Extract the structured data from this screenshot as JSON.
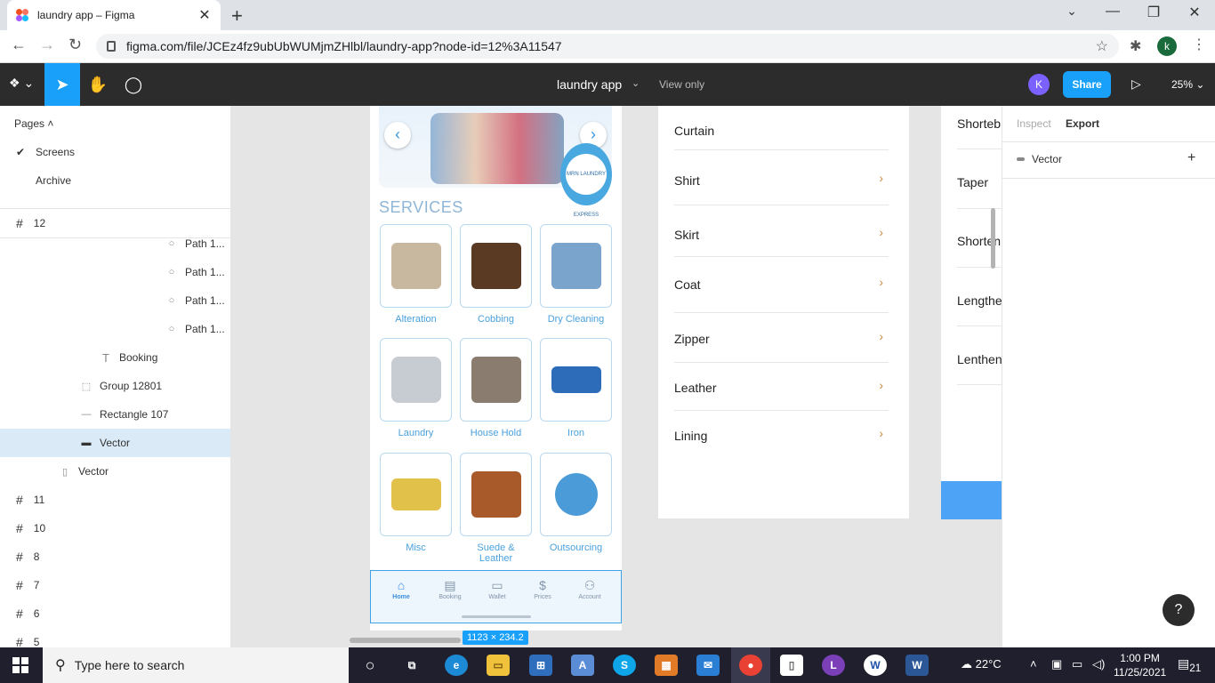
{
  "browser": {
    "tab_title": "laundry app – Figma",
    "tab_close": "✕",
    "new_tab": "+",
    "url": "figma.com/file/JCEz4fz9ubUbWUMjmZHlbl/laundry-app?node-id=12%3A11547",
    "profile_initial": "k",
    "controls": {
      "minimize": "—",
      "restore": "❐",
      "close": "✕",
      "chevron": "⌄"
    }
  },
  "figma": {
    "doc_title": "laundry app",
    "view_only": "View only",
    "avatar": "K",
    "share": "Share",
    "zoom": "25%",
    "tools": [
      "move-tool",
      "hand-tool",
      "comment-tool"
    ]
  },
  "left_panel": {
    "pages_header": "Pages ˄",
    "pages": [
      {
        "label": "Screens",
        "checked": true
      },
      {
        "label": "Archive",
        "checked": false
      }
    ],
    "layers": [
      {
        "label": "12",
        "type": "frame"
      },
      {
        "label": "Path 1...",
        "type": "path"
      },
      {
        "label": "Path 1...",
        "type": "path"
      },
      {
        "label": "Path 1...",
        "type": "path"
      },
      {
        "label": "Path 1...",
        "type": "path"
      },
      {
        "label": "Booking",
        "type": "text"
      },
      {
        "label": "Group 12801",
        "type": "group"
      },
      {
        "label": "Rectangle 107",
        "type": "rectangle"
      },
      {
        "label": "Vector",
        "type": "vector",
        "selected": true
      },
      {
        "label": "Vector",
        "type": "vector"
      },
      {
        "label": "11",
        "type": "frame"
      },
      {
        "label": "10",
        "type": "frame"
      },
      {
        "label": "8",
        "type": "frame"
      },
      {
        "label": "7",
        "type": "frame"
      },
      {
        "label": "6",
        "type": "frame"
      },
      {
        "label": "5",
        "type": "frame"
      }
    ]
  },
  "canvas": {
    "services_title": "SERVICES",
    "badge_text": "MRN LAUNDRY EXPRESS",
    "services": [
      {
        "label": "Alteration",
        "color": "#c9b8a0"
      },
      {
        "label": "Cobbing",
        "color": "#5a3a22"
      },
      {
        "label": "Dry Cleaning",
        "color": "#7aa4cc"
      },
      {
        "label": "Laundry",
        "color": "#c7ccd2"
      },
      {
        "label": "House Hold",
        "color": "#8a7d70"
      },
      {
        "label": "Iron",
        "color": "#2c6cb8"
      },
      {
        "label": "Misc",
        "color": "#e2c14a"
      },
      {
        "label": "Suede & Leather",
        "color": "#a85a2a"
      },
      {
        "label": "Outsourcing",
        "color": "#4b9bd8"
      }
    ],
    "bottom_nav": [
      {
        "label": "Home",
        "icon": "⌂",
        "active": true
      },
      {
        "label": "Booking",
        "icon": "▤",
        "active": false
      },
      {
        "label": "Wallet",
        "icon": "▭",
        "active": false
      },
      {
        "label": "Prices",
        "icon": "$",
        "active": false
      },
      {
        "label": "Account",
        "icon": "⚇",
        "active": false
      }
    ],
    "dimension_tag": "1123 × 234.2",
    "garments": [
      "Curtain",
      "Shirt",
      "Skirt",
      "Coat",
      "Zipper",
      "Leather",
      "Lining"
    ],
    "alterations": [
      "Shorteb",
      "Taper",
      "Shorten",
      "Lengthe",
      "Lenthen"
    ]
  },
  "right_panel": {
    "tabs": [
      "Inspect",
      "Export"
    ],
    "active_tab": "Export",
    "layer_name": "Vector",
    "add": "+",
    "help": "?"
  },
  "taskbar": {
    "search_placeholder": "Type here to search",
    "weather": "22°C",
    "time": "1:00 PM",
    "date": "11/25/2021",
    "notifications": "21"
  },
  "colors": {
    "figma_blue": "#18a0fb",
    "toolbar": "#2c2c2c",
    "accent": "#4aa1de",
    "chevron": "#d0883a"
  }
}
